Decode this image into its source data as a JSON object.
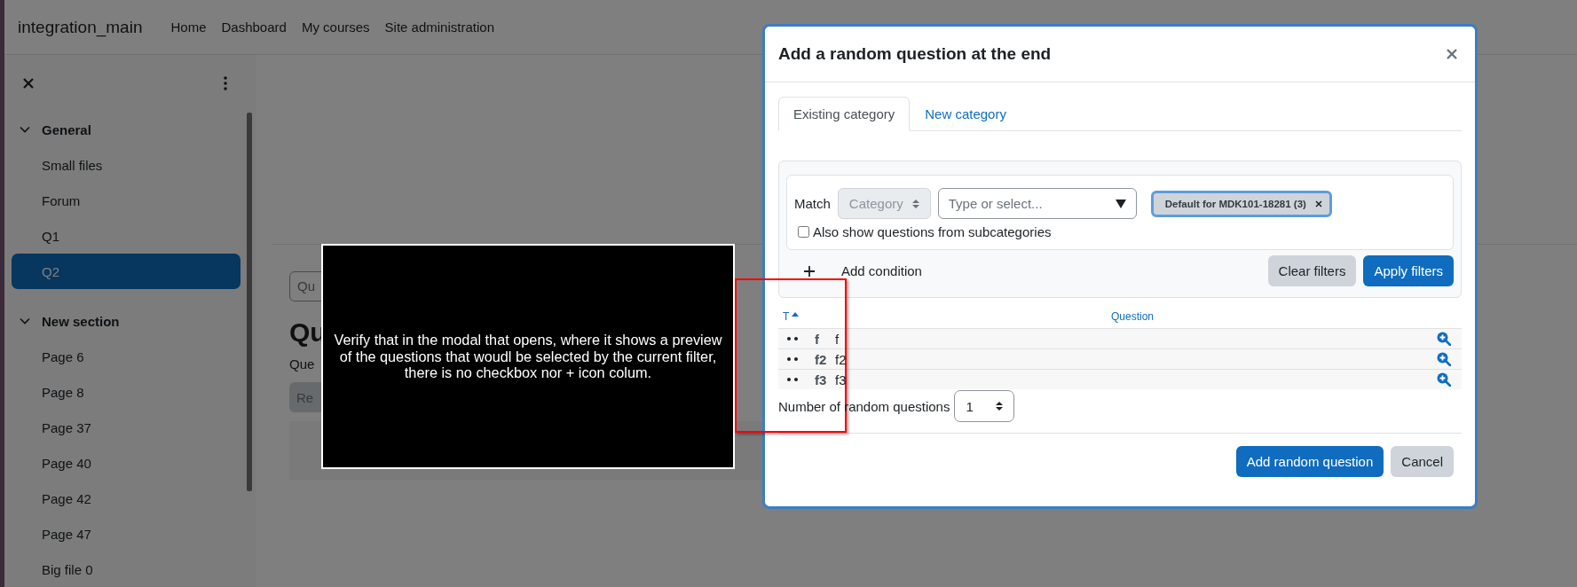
{
  "navbar": {
    "site_name": "integration_main",
    "links": [
      "Home",
      "Dashboard",
      "My courses",
      "Site administration"
    ]
  },
  "sidebar": {
    "sections": [
      {
        "title": "General",
        "expanded": true,
        "items": [
          {
            "label": "Small files",
            "selected": false
          },
          {
            "label": "Forum",
            "selected": false
          },
          {
            "label": "Q1",
            "selected": false
          },
          {
            "label": "Q2",
            "selected": true
          }
        ]
      },
      {
        "title": "New section",
        "expanded": true,
        "items": [
          {
            "label": "Page 6",
            "selected": false
          },
          {
            "label": "Page 8",
            "selected": false
          },
          {
            "label": "Page 37",
            "selected": false
          },
          {
            "label": "Page 40",
            "selected": false
          },
          {
            "label": "Page 42",
            "selected": false
          },
          {
            "label": "Page 47",
            "selected": false
          },
          {
            "label": "Big file 0",
            "selected": false
          }
        ]
      }
    ]
  },
  "page": {
    "search_text": "Qu",
    "heading": "Qu",
    "subtitle": "Que",
    "button": "Re"
  },
  "modal": {
    "title": "Add a random question at the end",
    "tabs": [
      {
        "label": "Existing category",
        "selected": true
      },
      {
        "label": "New category",
        "selected": false
      }
    ],
    "filter": {
      "match_label": "Match",
      "type_select": {
        "value": "Category",
        "disabled": true
      },
      "value_field": {
        "placeholder": "Type or select..."
      },
      "selected_tags": [
        "Default for MDK101-18281 (3)"
      ],
      "subcategories": {
        "label": "Also show questions from subcategories",
        "checked": false
      },
      "add_condition": "Add condition",
      "buttons": [
        {
          "label": "Clear filters",
          "kind": "secondary"
        },
        {
          "label": "Apply filters",
          "kind": "primary"
        }
      ]
    },
    "table": {
      "columns": [
        {
          "label": "T",
          "sorted": true
        },
        {
          "label": "Question",
          "sorted": false
        }
      ],
      "rows": [
        {
          "name": "f",
          "text": "f"
        },
        {
          "name": "f2",
          "text": "f2"
        },
        {
          "name": "f3",
          "text": "f3"
        }
      ]
    },
    "count": {
      "label": "Number of random questions",
      "value": "1"
    },
    "buttons": [
      {
        "label": "Add random question",
        "kind": "primary"
      },
      {
        "label": "Cancel",
        "kind": "secondary"
      }
    ]
  },
  "annotation": {
    "text": "Verify that in the modal that opens, where it shows a preview of the questions that woudl be selected by the current filter, there is no checkbox nor + icon colum."
  }
}
